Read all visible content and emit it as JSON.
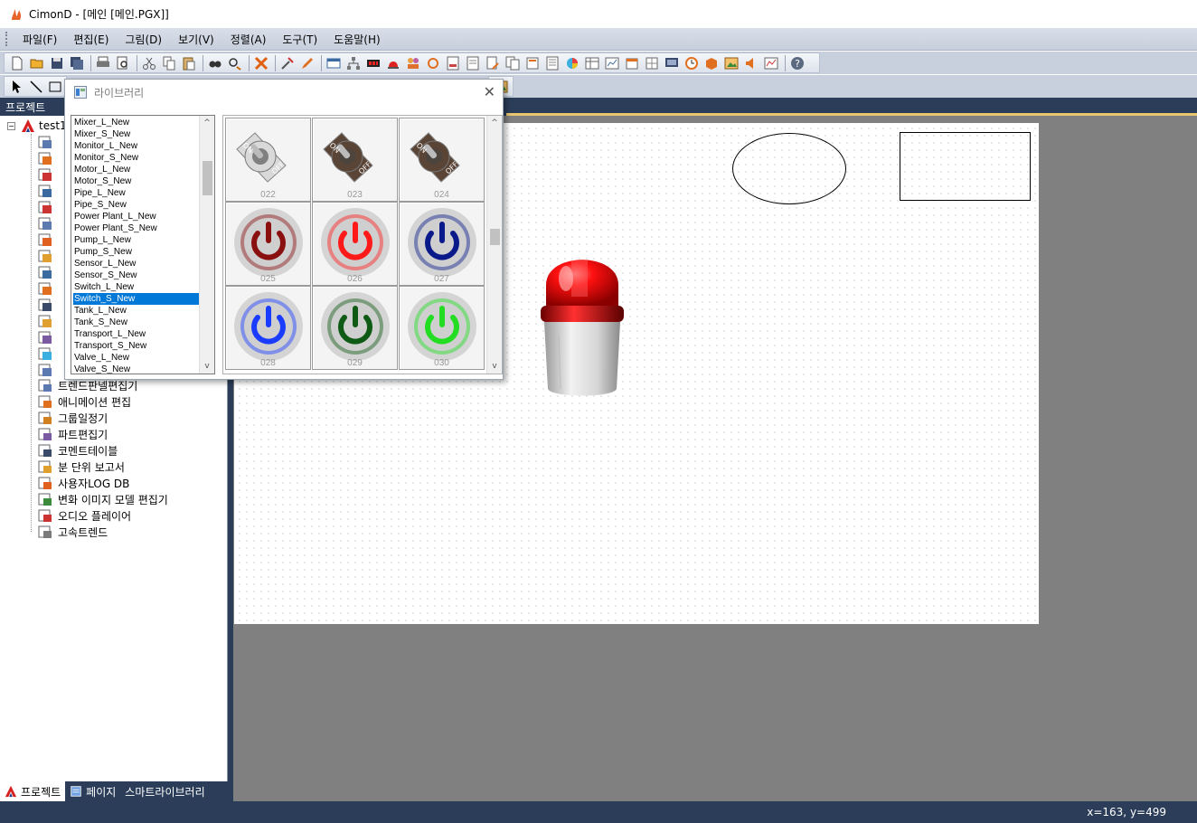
{
  "window": {
    "title": "CimonD - [메인 [메인.PGX]]"
  },
  "menu": [
    "파일(F)",
    "편집(E)",
    "그림(D)",
    "보기(V)",
    "정렬(A)",
    "도구(T)",
    "도움말(H)"
  ],
  "project_panel": {
    "header": "프로젝트",
    "root": "test1",
    "items": [
      "트렌드판넬편집기",
      "애니메이션 편집",
      "그룹일정기",
      "파트편집기",
      "코멘트테이블",
      "분 단위 보고서",
      "사용자LOG DB",
      "변화 이미지 모델 편집기",
      "오디오 플레이어",
      "고속트렌드"
    ],
    "tabs": [
      "프로젝트",
      "페이지",
      "스마트라이브러리"
    ]
  },
  "library_dialog": {
    "title": "라이브러리",
    "categories": [
      "Mixer_L_New",
      "Mixer_S_New",
      "Monitor_L_New",
      "Monitor_S_New",
      "Motor_L_New",
      "Motor_S_New",
      "Pipe_L_New",
      "Pipe_S_New",
      "Power Plant_L_New",
      "Power Plant_S_New",
      "Pump_L_New",
      "Pump_S_New",
      "Sensor_L_New",
      "Sensor_S_New",
      "Switch_L_New",
      "Switch_S_New",
      "Tank_L_New",
      "Tank_S_New",
      "Transport_L_New",
      "Transport_S_New",
      "Valve_L_New",
      "Valve_S_New"
    ],
    "selected": "Switch_S_New",
    "thumbnails": [
      {
        "num": "022",
        "kind": "toggle",
        "color": "#d9d9d9"
      },
      {
        "num": "023",
        "kind": "toggle",
        "color": "#5a4436"
      },
      {
        "num": "024",
        "kind": "toggle",
        "color": "#5a4436"
      },
      {
        "num": "025",
        "kind": "power",
        "color": "#8a1010"
      },
      {
        "num": "026",
        "kind": "power",
        "color": "#ff1a1a"
      },
      {
        "num": "027",
        "kind": "power",
        "color": "#0a1a8a"
      },
      {
        "num": "028",
        "kind": "power",
        "color": "#1a3cff"
      },
      {
        "num": "029",
        "kind": "power",
        "color": "#0f5a14"
      },
      {
        "num": "030",
        "kind": "power",
        "color": "#22dd22"
      }
    ]
  },
  "toggle_labels": {
    "on": "ON",
    "off": "OFF"
  },
  "status": {
    "coords": "x=163, y=499"
  },
  "colors": {
    "panel_dark": "#2b3d58",
    "selection": "#0078d7",
    "workspace": "#808080"
  }
}
